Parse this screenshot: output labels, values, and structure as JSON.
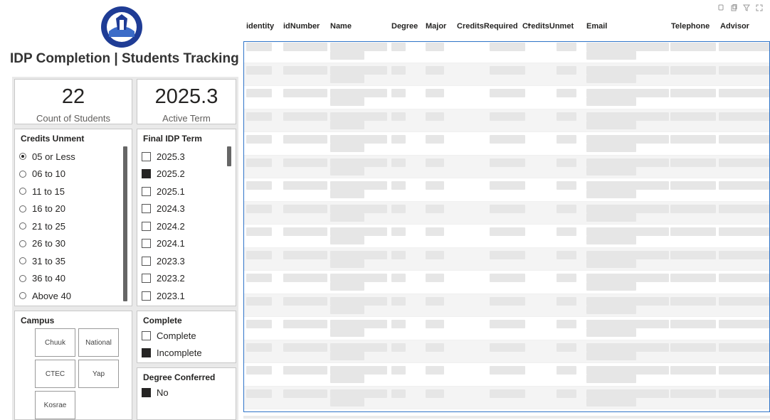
{
  "dashboard": {
    "title": "IDP Completion | Students Tracking"
  },
  "kpis": [
    {
      "value": "22",
      "label": "Count of Students"
    },
    {
      "value": "2025.3",
      "label": "Active Term"
    }
  ],
  "credits_slicer": {
    "title": "Credits Unment",
    "selected": "05 or Less",
    "items": [
      "05 or Less",
      "06 to 10",
      "11 to 15",
      "16 to 20",
      "21 to 25",
      "26 to 30",
      "31 to 35",
      "36 to 40",
      "Above 40"
    ]
  },
  "term_slicer": {
    "title": "Final IDP Term",
    "selected": "2025.2",
    "items": [
      "2025.3",
      "2025.2",
      "2025.1",
      "2024.3",
      "2024.2",
      "2024.1",
      "2023.3",
      "2023.2",
      "2023.1"
    ]
  },
  "campus_slicer": {
    "title": "Campus",
    "tiles": [
      "Chuuk",
      "National",
      "CTEC",
      "Yap",
      "Kosrae"
    ]
  },
  "complete_slicer": {
    "title": "Complete",
    "items": [
      "Complete",
      "Incomplete"
    ],
    "selected": "Incomplete"
  },
  "degree_slicer": {
    "title": "Degree Conferred",
    "items": [
      "No"
    ],
    "selected": "No"
  },
  "table": {
    "columns": [
      "identity",
      "idNumber",
      "Name",
      "Degree",
      "Major",
      "CreditsRequired",
      "CreditsUnmet",
      "Email",
      "Telephone",
      "Advisor"
    ],
    "sorted_column": "CreditsUnmet",
    "row_count_visible": 16
  },
  "visual_icons": [
    "pin-icon",
    "copy-icon",
    "filter-icon",
    "focus-mode-icon"
  ],
  "colors": {
    "selection_border": "#2f74c8",
    "checked_fill": "#252423"
  }
}
